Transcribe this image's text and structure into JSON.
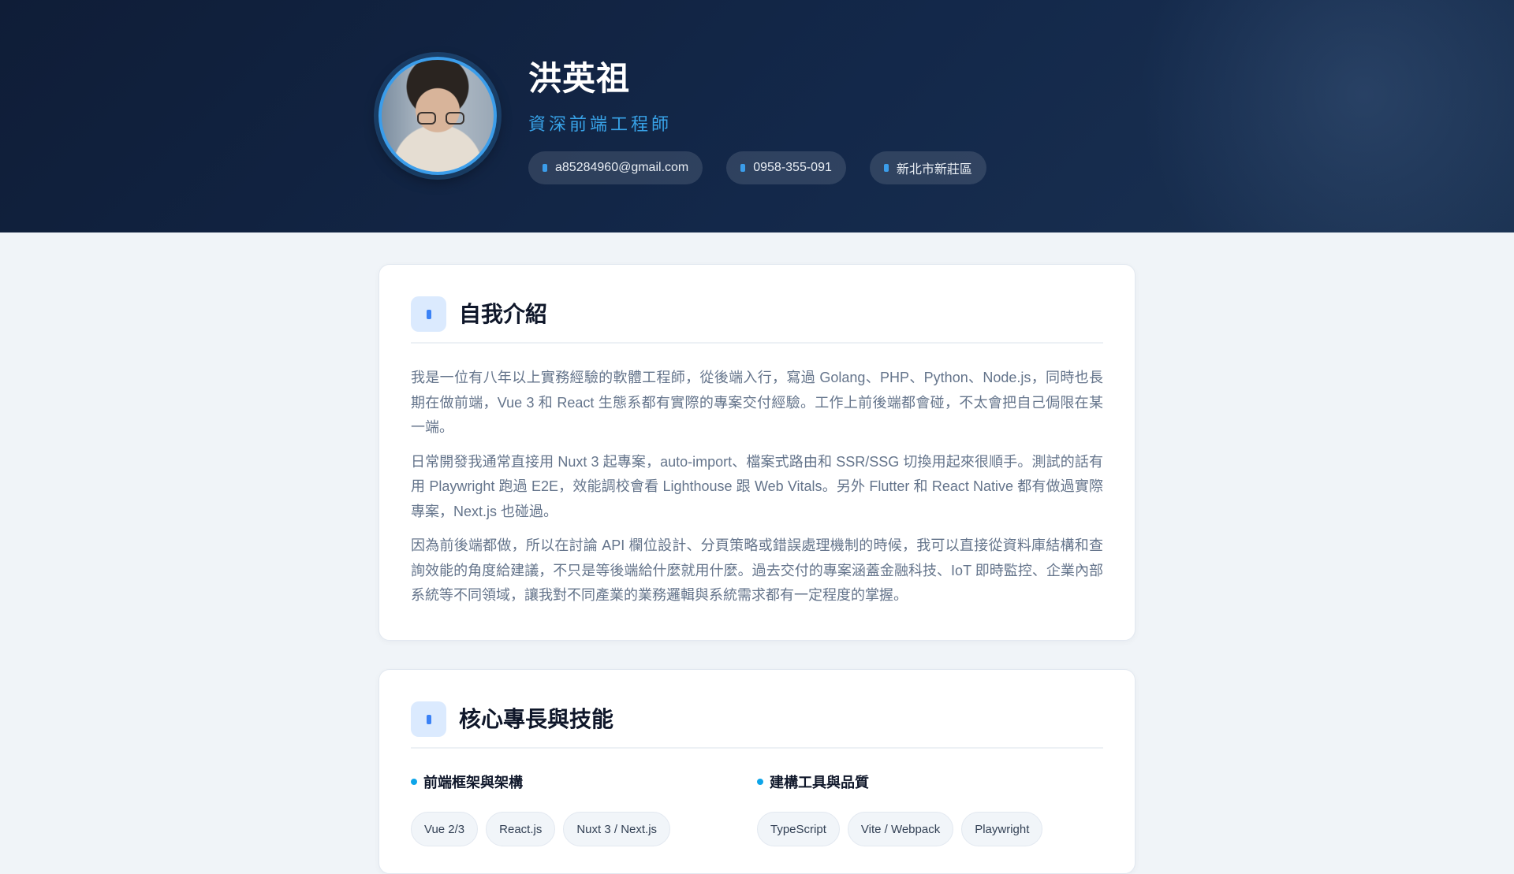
{
  "profile": {
    "name": "洪英祖",
    "role": "資深前端工程師",
    "contacts": [
      {
        "icon": "mail-icon",
        "text": "a85284960@gmail.com"
      },
      {
        "icon": "phone-icon",
        "text": "0958-355-091"
      },
      {
        "icon": "location-icon",
        "text": "新北市新莊區"
      }
    ]
  },
  "intro": {
    "title": "自我介紹",
    "icon": "user-icon",
    "paragraphs": [
      "我是一位有八年以上實務經驗的軟體工程師，從後端入行，寫過 Golang、PHP、Python、Node.js，同時也長期在做前端，Vue 3 和 React 生態系都有實際的專案交付經驗。工作上前後端都會碰，不太會把自己侷限在某一端。",
      "日常開發我通常直接用 Nuxt 3 起專案，auto-import、檔案式路由和 SSR/SSG 切換用起來很順手。測試的話有用 Playwright 跑過 E2E，效能調校會看 Lighthouse 跟 Web Vitals。另外 Flutter 和 React Native 都有做過實際專案，Next.js 也碰過。",
      "因為前後端都做，所以在討論 API 欄位設計、分頁策略或錯誤處理機制的時候，我可以直接從資料庫結構和查詢效能的角度給建議，不只是等後端給什麼就用什麼。過去交付的專案涵蓋金融科技、IoT 即時監控、企業內部系統等不同領域，讓我對不同產業的業務邏輯與系統需求都有一定程度的掌握。"
    ]
  },
  "skills": {
    "title": "核心專長與技能",
    "icon": "code-icon",
    "groups": [
      {
        "heading": "前端框架與架構",
        "tags": [
          "Vue 2/3",
          "React.js",
          "Nuxt 3 / Next.js"
        ]
      },
      {
        "heading": "建構工具與品質",
        "tags": [
          "TypeScript",
          "Vite / Webpack",
          "Playwright"
        ]
      }
    ]
  },
  "colors": {
    "header_bg": "#0f1d37",
    "accent": "#38a3e8",
    "page_bg": "#f0f4f8"
  }
}
